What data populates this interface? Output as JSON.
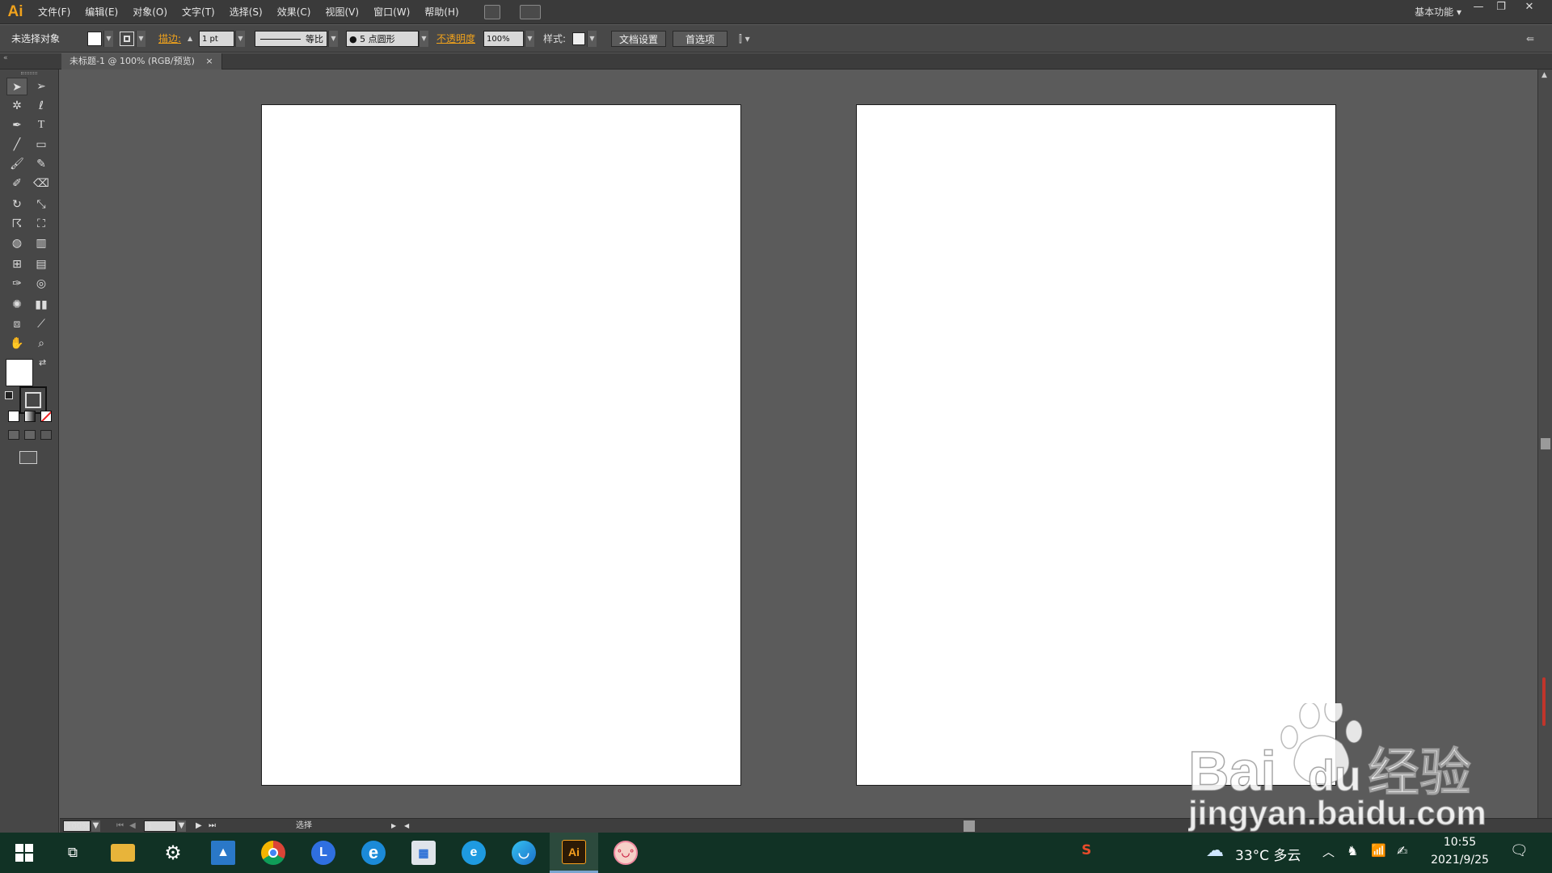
{
  "app": {
    "logo": "Ai",
    "menus": [
      "文件(F)",
      "编辑(E)",
      "对象(O)",
      "文字(T)",
      "选择(S)",
      "效果(C)",
      "视图(V)",
      "窗口(W)",
      "帮助(H)"
    ],
    "workspace": "基本功能"
  },
  "control": {
    "selection": "未选择对象",
    "stroke_label": "描边:",
    "stroke_value": "1 pt",
    "profile": "等比",
    "brush": "5 点圆形",
    "opacity_label": "不透明度",
    "opacity_value": "100%",
    "style_label": "样式:",
    "doc_setup": "文档设置",
    "prefs": "首选项"
  },
  "document": {
    "tab_title": "未标题-1 @ 100% (RGB/预览)",
    "tab_close": "×"
  },
  "status": {
    "zoom": "100%",
    "artboard_num": "1",
    "mode": "选择"
  },
  "toolbox": {
    "icons": [
      "selection-tool-icon",
      "direct-selection-tool-icon",
      "magic-wand-tool-icon",
      "lasso-tool-icon",
      "pen-tool-icon",
      "type-tool-icon",
      "line-tool-icon",
      "rectangle-tool-icon",
      "paintbrush-tool-icon",
      "pencil-tool-icon",
      "blob-brush-tool-icon",
      "eraser-tool-icon",
      "rotate-tool-icon",
      "scale-tool-icon",
      "warp-tool-icon",
      "free-transform-tool-icon",
      "shape-builder-tool-icon",
      "perspective-grid-tool-icon",
      "mesh-tool-icon",
      "gradient-tool-icon",
      "eyedropper-tool-icon",
      "blend-tool-icon",
      "symbol-sprayer-tool-icon",
      "column-graph-tool-icon",
      "artboard-tool-icon",
      "slice-tool-icon",
      "hand-tool-icon",
      "zoom-tool-icon"
    ]
  },
  "taskbar": {
    "weather": "33°C 多云",
    "time": "10:55",
    "date": "2021/9/25",
    "ai_label": "Ai"
  },
  "watermark": {
    "brand": "Bai",
    "brand2": "du",
    "product": "经验",
    "url": "jingyan.baidu.com"
  },
  "colors": {
    "accent": "#f0a21c",
    "canvas": "#5b5b5b",
    "taskbar": "#113225"
  }
}
